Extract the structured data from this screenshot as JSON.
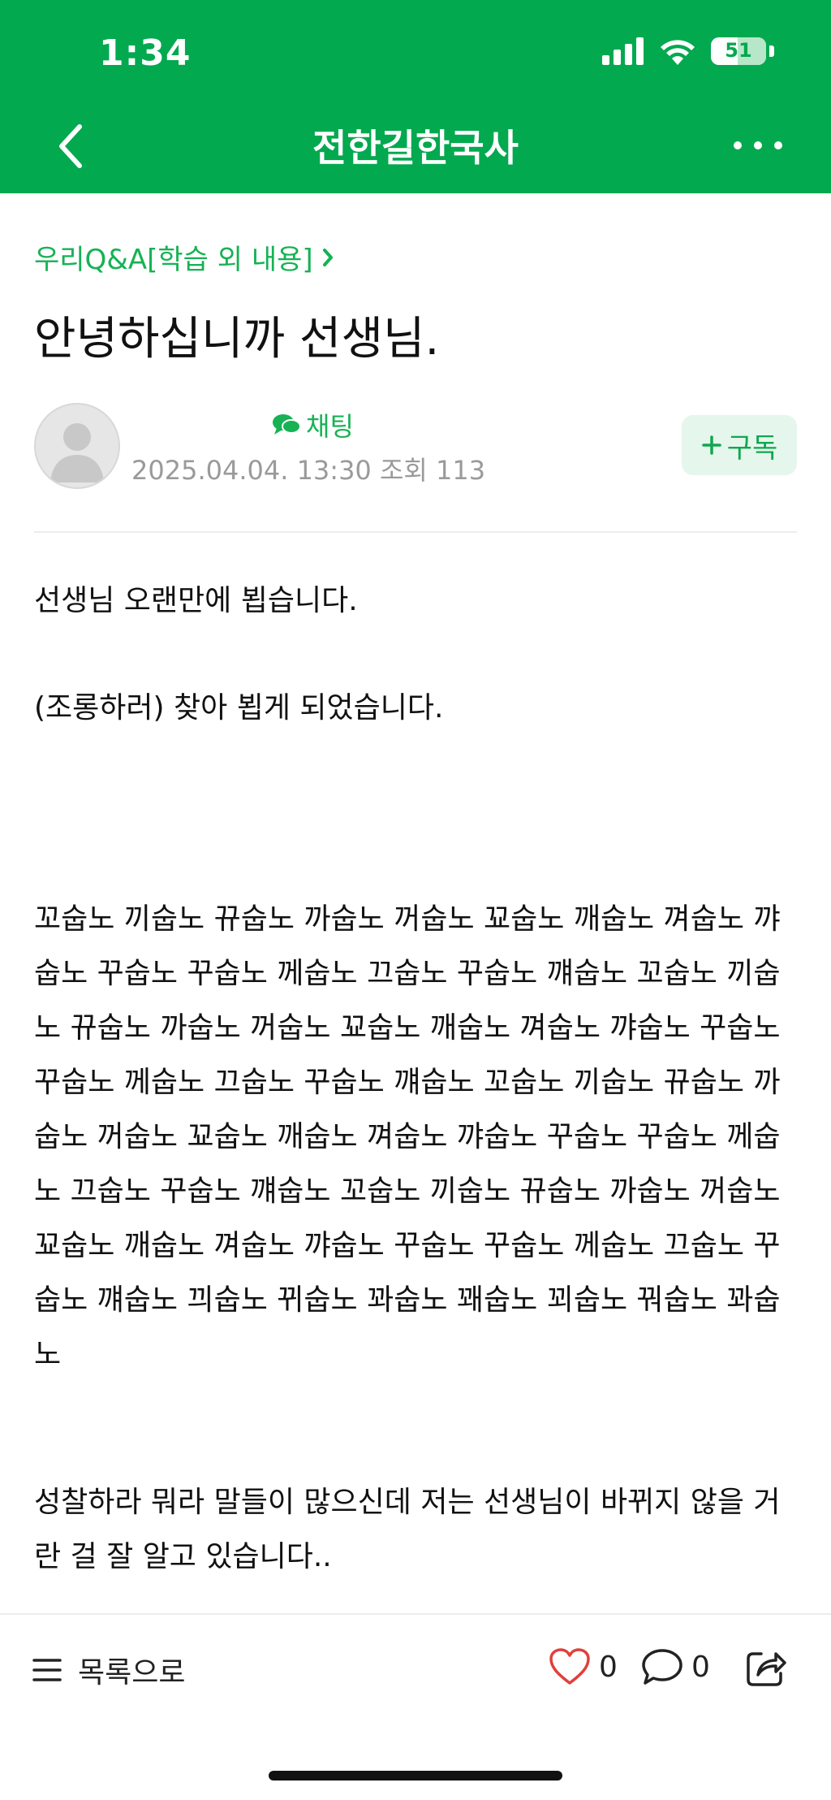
{
  "status": {
    "time": "1:34",
    "battery": "51"
  },
  "nav": {
    "title": "전한길한국사"
  },
  "post": {
    "category": "우리Q&A[학습 외 내용]",
    "title": "안녕하십니까 선생님.",
    "chat_label": "채팅",
    "meta": "2025.04.04. 13:30 조회 113",
    "subscribe_label": "구독",
    "body": [
      "선생님 오랜만에 뵙습니다.",
      "(조롱하러) 찾아 뵙게 되었습니다.",
      "꼬숩노 끼숩노 뀨숩노 까숩노 꺼숩노 꾜숩노 깨숩노 껴숩노 꺄숩노 꾸숩노 꾸숩노 께숩노 끄숩노 꾸숩노 꺠숩노 꼬숩노 끼숩노 뀨숩노 까숩노 꺼숩노 꾜숩노 깨숩노 껴숩노 꺄숩노 꾸숩노 꾸숩노 께숩노 끄숩노 꾸숩노 꺠숩노 꼬숩노 끼숩노 뀨숩노 까숩노 꺼숩노 꾜숩노 깨숩노 껴숩노 꺄숩노 꾸숩노 꾸숩노 께숩노 끄숩노 꾸숩노 꺠숩노 꼬숩노 끼숩노 뀨숩노 까숩노 꺼숩노 꾜숩노 깨숩노 껴숩노 꺄숩노 꾸숩노 꾸숩노 께숩노 끄숩노 꾸숩노 꺠숩노 끠숩노 뀌숩노 꽈숩노 꽤숩노 꾀숩노 꿔숩노 꽈숩노",
      "성찰하라 뭐라 말들이 많으신데 저는 선생님이 바뀌지 않을 거란 걸 잘 알고 있습니다.."
    ]
  },
  "bottom": {
    "list_label": "목록으로",
    "like_count": "0",
    "comment_count": "0"
  }
}
